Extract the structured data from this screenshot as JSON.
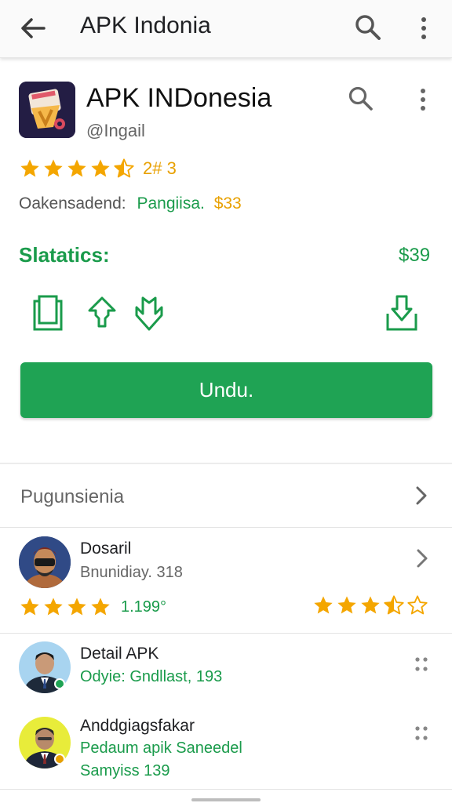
{
  "topbar": {
    "title": "APK Indonia"
  },
  "app": {
    "name": "APK INDonesia",
    "handle": "@Ingail",
    "stars": 4.5,
    "rating_count": "2# 3",
    "meta_label": "Oakensadend:",
    "meta_value": "Pangiisa.",
    "meta_price": "$33"
  },
  "stats": {
    "label": "Slatatics:",
    "price": "$39"
  },
  "actions": {
    "download_label": "Undu."
  },
  "section": {
    "title": "Pugunsienia"
  },
  "reviews": [
    {
      "name": "Dosaril",
      "sub": "Bnunidiay. 318",
      "stars": 4,
      "count": "1.199°",
      "right_stars": 3.5
    },
    {
      "name": "Detail APK",
      "sub": "Odyie: Gndllast, 193"
    },
    {
      "name": "Anddgiagsfakar",
      "sub": "Pedaum apik Saneedel",
      "sub2": "Samyiss 139"
    }
  ],
  "colors": {
    "accent": "#1fa354",
    "star": "#f4a600",
    "text_green": "#1a9b4b"
  }
}
